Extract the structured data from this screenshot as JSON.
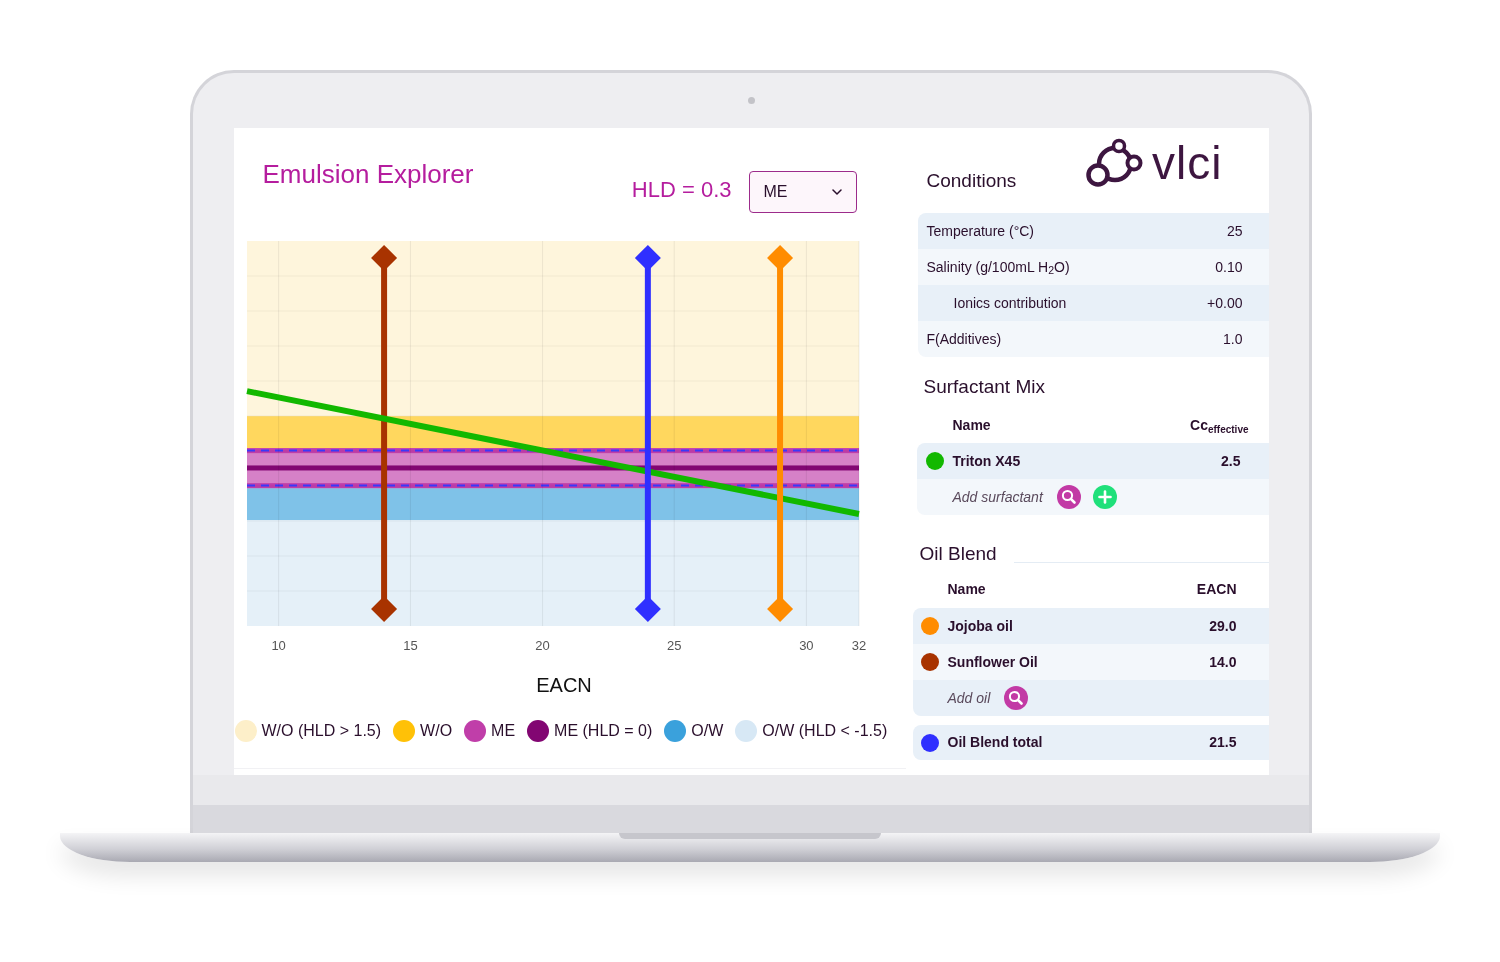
{
  "explorer": {
    "title": "Emulsion Explorer",
    "hld_readout": "HLD = 0.3",
    "phase_select": {
      "value": "ME"
    },
    "plot": {
      "markers": [
        {
          "color": "#a83300"
        },
        {
          "color": "#2f2fff"
        },
        {
          "color": "#ff8c00"
        }
      ],
      "x_tick_labels": [
        "10",
        "15",
        "20",
        "25",
        "30",
        "32"
      ],
      "x_axis_title": "EACN"
    },
    "legend": [
      {
        "label": "W/O (HLD > 1.5)",
        "color": "#fdefc9"
      },
      {
        "label": "W/O",
        "color": "#ffc107"
      },
      {
        "label": "ME",
        "color": "#c03ea9"
      },
      {
        "label": "ME (HLD = 0)",
        "color": "#820672"
      },
      {
        "label": "O/W",
        "color": "#3aa1dc"
      },
      {
        "label": "O/W (HLD < -1.5)",
        "color": "#d7e8f5"
      }
    ]
  },
  "logo": {
    "text": "vlci"
  },
  "conditions": {
    "title": "Conditions",
    "rows": [
      {
        "label": "Temperature (°C)",
        "value": "25"
      },
      {
        "label": "Salinity (g/100mL H$_{2}$O)",
        "value": "0.10",
        "children": [
          {
            "label": "Ionics contribution",
            "value": "+0.00"
          }
        ]
      },
      {
        "label": "F(Additives)",
        "value": "1.0"
      }
    ]
  },
  "surfactant_mix": {
    "title": "Surfactant Mix",
    "columns": [
      "Name",
      "Cc$_{effective}$"
    ],
    "rows": [
      {
        "name": "Triton X45",
        "value": "2.5",
        "color": "#12b800"
      }
    ],
    "add_label": "Add surfactant",
    "add_actions": [
      {
        "kind": "search"
      },
      {
        "kind": "add"
      }
    ]
  },
  "oil_blend": {
    "title": "Oil Blend",
    "columns": [
      "Name",
      "EACN"
    ],
    "rows": [
      {
        "name": "Jojoba oil",
        "value": "29.0",
        "color": "#ff8c00"
      },
      {
        "name": "Sunflower Oil",
        "value": "14.0",
        "color": "#a83300"
      }
    ],
    "add_label": "Add oil",
    "add_actions": [
      {
        "kind": "search"
      }
    ],
    "total": {
      "name": "Oil Blend total",
      "value": "21.5",
      "color": "#2f2fff"
    }
  }
}
